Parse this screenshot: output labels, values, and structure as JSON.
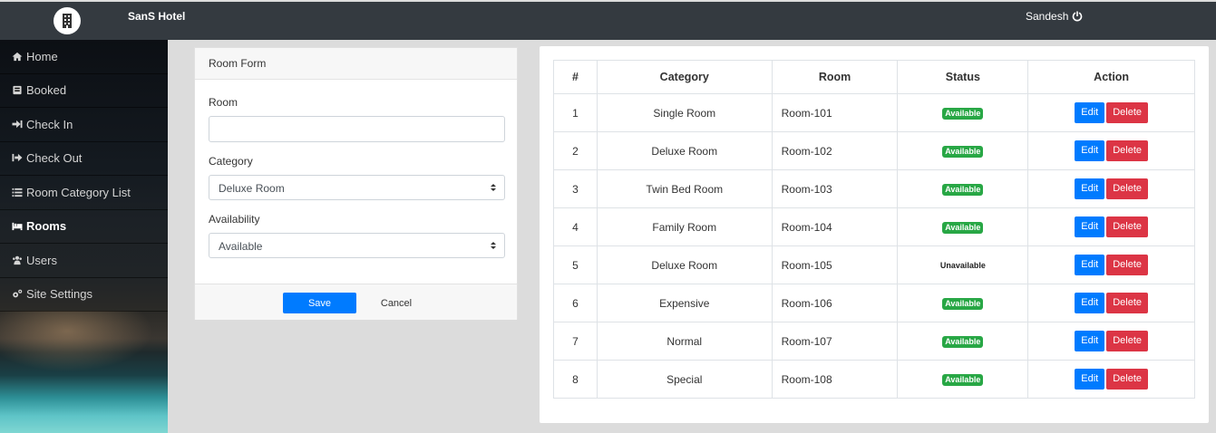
{
  "header": {
    "brand": "SanS Hotel",
    "user": "Sandesh"
  },
  "sidebar": {
    "items": [
      {
        "label": "Home",
        "icon": "home-icon"
      },
      {
        "label": "Booked",
        "icon": "book-icon"
      },
      {
        "label": "Check In",
        "icon": "sign-in-icon"
      },
      {
        "label": "Check Out",
        "icon": "sign-out-icon"
      },
      {
        "label": "Room Category List",
        "icon": "list-icon"
      },
      {
        "label": "Rooms",
        "icon": "bed-icon",
        "active": true
      },
      {
        "label": "Users",
        "icon": "users-icon"
      },
      {
        "label": "Site Settings",
        "icon": "cogs-icon"
      }
    ]
  },
  "form": {
    "title": "Room Form",
    "room_label": "Room",
    "room_value": "",
    "category_label": "Category",
    "category_selected": "Deluxe Room",
    "availability_label": "Availability",
    "availability_selected": "Available",
    "save_label": "Save",
    "cancel_label": "Cancel"
  },
  "table": {
    "headers": [
      "#",
      "Category",
      "Room",
      "Status",
      "Action"
    ],
    "edit_label": "Edit",
    "delete_label": "Delete",
    "rows": [
      {
        "num": "1",
        "category": "Single Room",
        "room": "Room-101",
        "status": "Available"
      },
      {
        "num": "2",
        "category": "Deluxe Room",
        "room": "Room-102",
        "status": "Available"
      },
      {
        "num": "3",
        "category": "Twin Bed Room",
        "room": "Room-103",
        "status": "Available"
      },
      {
        "num": "4",
        "category": "Family Room",
        "room": "Room-104",
        "status": "Available"
      },
      {
        "num": "5",
        "category": "Deluxe Room",
        "room": "Room-105",
        "status": "Unavailable"
      },
      {
        "num": "6",
        "category": "Expensive",
        "room": "Room-106",
        "status": "Available"
      },
      {
        "num": "7",
        "category": "Normal",
        "room": "Room-107",
        "status": "Available"
      },
      {
        "num": "8",
        "category": "Special",
        "room": "Room-108",
        "status": "Available"
      }
    ]
  },
  "colors": {
    "primary": "#007bff",
    "danger": "#dc3545",
    "success": "#28a745",
    "topbar": "#343a40"
  }
}
